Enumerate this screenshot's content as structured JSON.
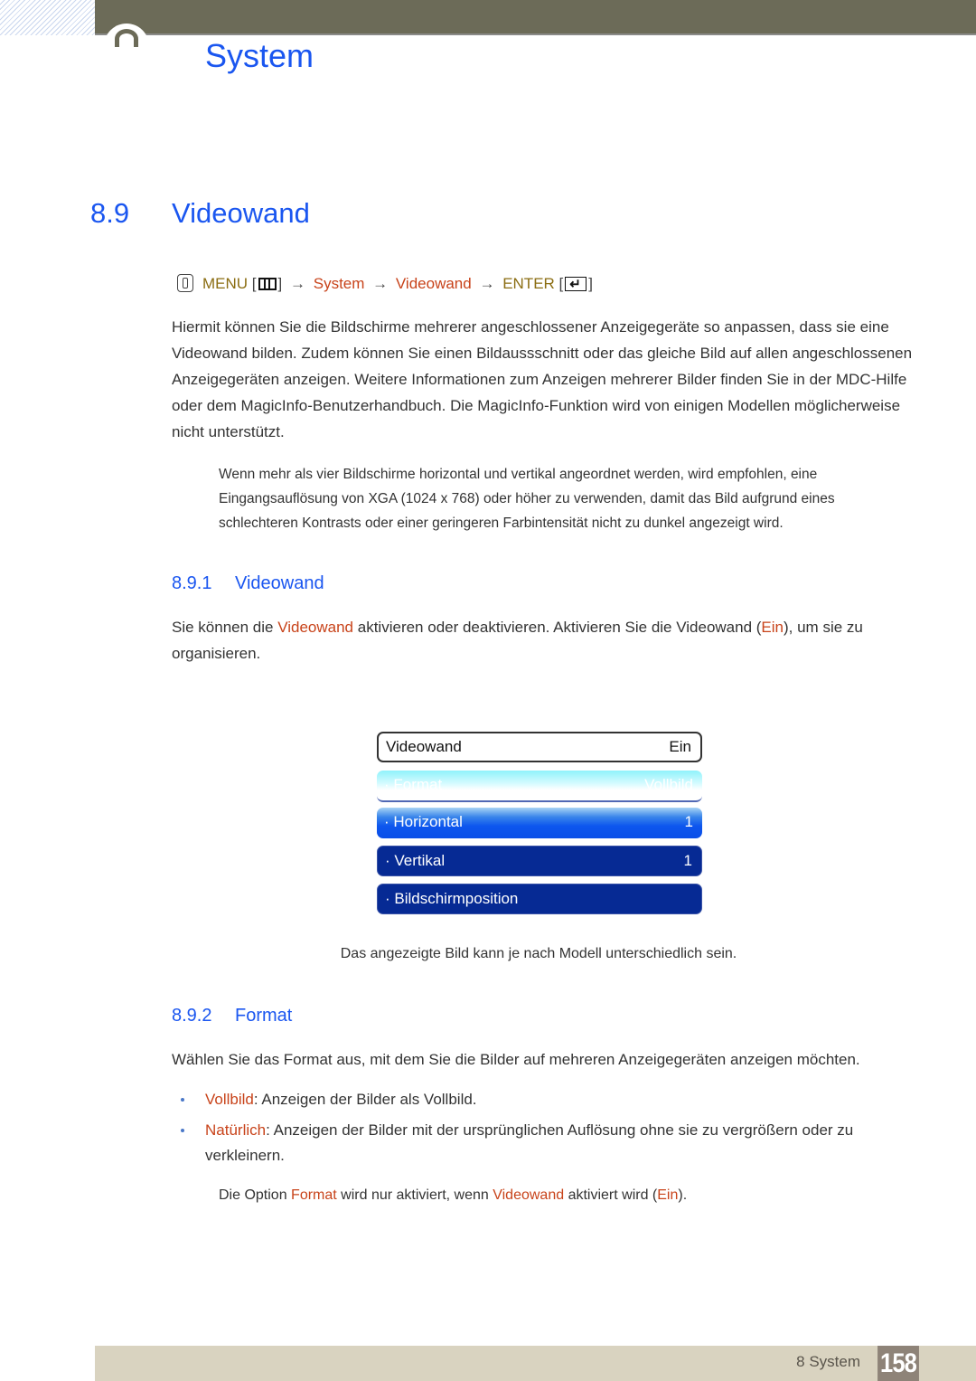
{
  "header": {
    "chapter_title": "System"
  },
  "section": {
    "number": "8.9",
    "title": "Videowand"
  },
  "menu_path": {
    "menu": "MENU",
    "system": "System",
    "videowand": "Videowand",
    "enter": "ENTER",
    "arrow": "→",
    "open_bracket": "[",
    "close_bracket": "]",
    "icons": [
      "touch-hand-icon",
      "menu-icon",
      "enter-icon"
    ]
  },
  "intro_paragraph": "Hiermit können Sie die Bildschirme mehrerer angeschlossener Anzeigegeräte so anpassen, dass sie eine Videowand bilden. Zudem können Sie einen Bildaussschnitt oder das gleiche Bild auf allen angeschlossenen Anzeigegeräten anzeigen. Weitere Informationen zum Anzeigen mehrerer Bilder finden Sie in der MDC-Hilfe oder dem MagicInfo-Benutzerhandbuch. Die MagicInfo-Funktion wird von einigen Modellen möglicherweise nicht unterstützt.",
  "note_1": "Wenn mehr als vier Bildschirme horizontal und vertikal angeordnet werden, wird empfohlen, eine Eingangsauflösung von XGA (1024 x 768) oder höher zu verwenden, damit das Bild aufgrund eines schlechteren Kontrasts oder einer geringeren Farbintensität nicht zu dunkel angezeigt wird.",
  "subsection_1": {
    "number": "8.9.1",
    "title": "Videowand",
    "text_before": "Sie können die ",
    "kw_videowand": "Videowand",
    "text_middle": " aktivieren oder deaktivieren. Aktivieren Sie die Videowand (",
    "kw_ein": "Ein",
    "text_after": "), um sie zu organisieren."
  },
  "osd_menu": {
    "rows": [
      {
        "label": "Videowand",
        "value": "Ein",
        "state": "selected"
      },
      {
        "label": "· Format",
        "value": "Vollbild",
        "state": "disabled"
      },
      {
        "label": "· Horizontal",
        "value": "1",
        "state": "highlighted"
      },
      {
        "label": "· Vertikal",
        "value": "1",
        "state": "normal"
      },
      {
        "label": "· Bildschirmposition",
        "value": "",
        "state": "normal"
      }
    ],
    "caption": "Das angezeigte Bild kann je nach Modell unterschiedlich sein."
  },
  "subsection_2": {
    "number": "8.9.2",
    "title": "Format",
    "intro": "Wählen Sie das Format aus, mit dem Sie die Bilder auf mehreren Anzeigegeräten anzeigen möchten.",
    "bullets": [
      {
        "term": "Vollbild",
        "desc": ": Anzeigen der Bilder als Vollbild."
      },
      {
        "term": "Natürlich",
        "desc": ": Anzeigen der Bilder mit der ursprünglichen Auflösung ohne sie zu vergrößern oder zu verkleinern."
      }
    ],
    "note": {
      "t1": "Die Option ",
      "kw_format": "Format",
      "t2": " wird nur aktiviert, wenn ",
      "kw_videowand": "Videowand",
      "t3": " aktiviert wird (",
      "kw_ein": "Ein",
      "t4": ")."
    }
  },
  "footer": {
    "chapter_label": "8 System",
    "page_number": "158"
  },
  "colors": {
    "heading_blue": "#1a56f0",
    "keyword_red": "#c8431a",
    "keyword_olive": "#8b6d12",
    "header_bar": "#6c6b58",
    "footer_bar": "#d9d3c0",
    "page_badge": "#8e8378"
  }
}
